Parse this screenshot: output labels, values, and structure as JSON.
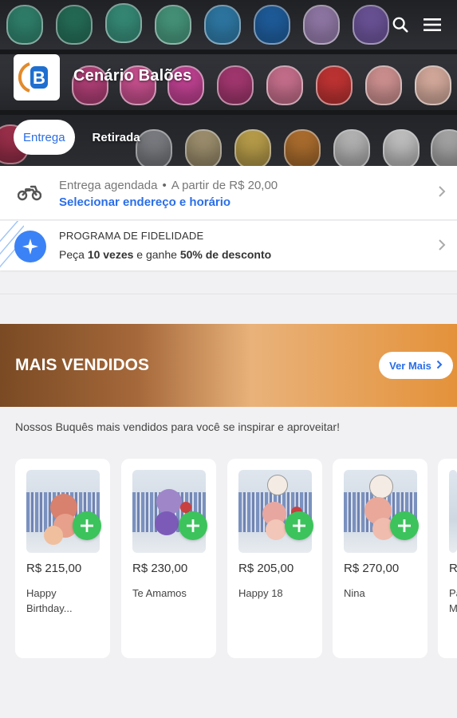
{
  "header": {
    "store_name": "Cenário Balões",
    "logo_letter": "B",
    "tabs": [
      {
        "label": "Entrega",
        "active": true
      },
      {
        "label": "Retirada",
        "active": false
      }
    ]
  },
  "delivery": {
    "type": "Entrega agendada",
    "min_price": "A partir de R$ 20,00",
    "select_link": "Selecionar endereço e horário"
  },
  "loyalty": {
    "title": "PROGRAMA DE FIDELIDADE",
    "text_a": "Peça ",
    "text_b": "10 vezes",
    "text_c": " e ganhe ",
    "text_d": "50% de desconto"
  },
  "section": {
    "title": "MAIS VENDIDOS",
    "see_more": "Ver Mais",
    "subtitle": "Nossos Buquês mais vendidos para você se inspirar e aproveitar!"
  },
  "products": [
    {
      "price": "R$ 215,00",
      "name": "Happy Birthday..."
    },
    {
      "price": "R$ 230,00",
      "name": "Te Amamos"
    },
    {
      "price": "R$ 205,00",
      "name": "Happy 18"
    },
    {
      "price": "R$ 270,00",
      "name": "Nina"
    },
    {
      "price": "R",
      "name": "Pa M"
    }
  ],
  "colors": {
    "accent_blue": "#2a6ee8",
    "add_green": "#3cc35c",
    "banner_brown": "#7a4a24",
    "banner_orange": "#e4923a"
  },
  "icons": {
    "search": "search-icon",
    "menu": "menu-icon",
    "delivery": "motorcycle-icon",
    "loyalty": "star-badge-icon",
    "chevron": "chevron-right-icon",
    "add": "plus-icon"
  }
}
